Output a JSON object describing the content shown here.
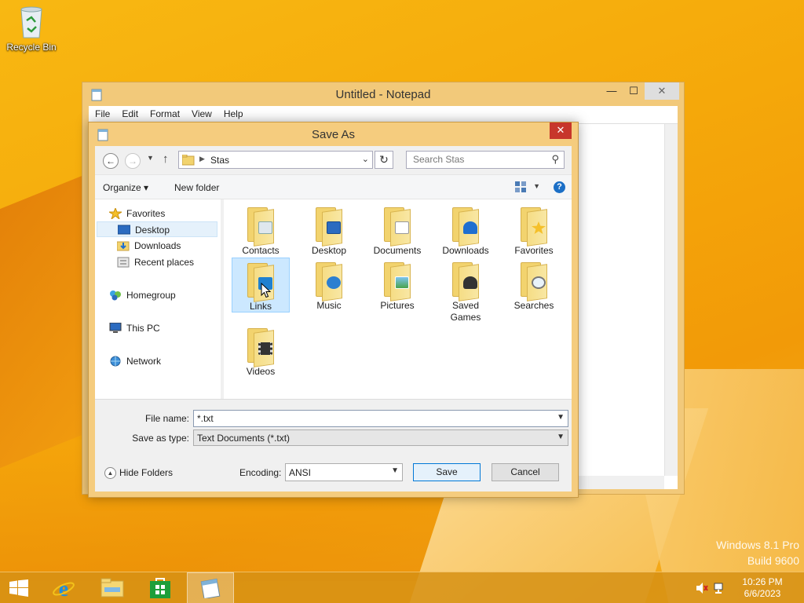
{
  "desktop": {
    "recycle_bin_label": "Recycle Bin",
    "watermark_line1": "Windows 8.1 Pro",
    "watermark_line2": "Build 9600"
  },
  "notepad": {
    "title": "Untitled - Notepad",
    "menu": [
      "File",
      "Edit",
      "Format",
      "View",
      "Help"
    ]
  },
  "dialog": {
    "title": "Save As",
    "close_glyph": "✕",
    "address_crumb": "Stas",
    "search_placeholder": "Search Stas",
    "organize_label": "Organize ▾",
    "new_folder_label": "New folder",
    "nav": {
      "favorites": "Favorites",
      "desktop": "Desktop",
      "downloads": "Downloads",
      "recent_places": "Recent places",
      "homegroup": "Homegroup",
      "this_pc": "This PC",
      "network": "Network"
    },
    "folders": [
      "Contacts",
      "Desktop",
      "Documents",
      "Downloads",
      "Favorites",
      "Links",
      "Music",
      "Pictures",
      "Saved Games",
      "Searches",
      "Videos"
    ],
    "file_name_label": "File name:",
    "file_name_value": "*.txt",
    "save_type_label": "Save as type:",
    "save_type_value": "Text Documents (*.txt)",
    "hide_folders_label": "Hide Folders",
    "encoding_label": "Encoding:",
    "encoding_value": "ANSI",
    "save_label": "Save",
    "cancel_label": "Cancel"
  },
  "taskbar": {
    "time": "10:26 PM",
    "date": "6/6/2023"
  },
  "colors": {
    "accent": "#f5cc7e",
    "selection": "#cce8ff",
    "close_red": "#c7362b"
  }
}
